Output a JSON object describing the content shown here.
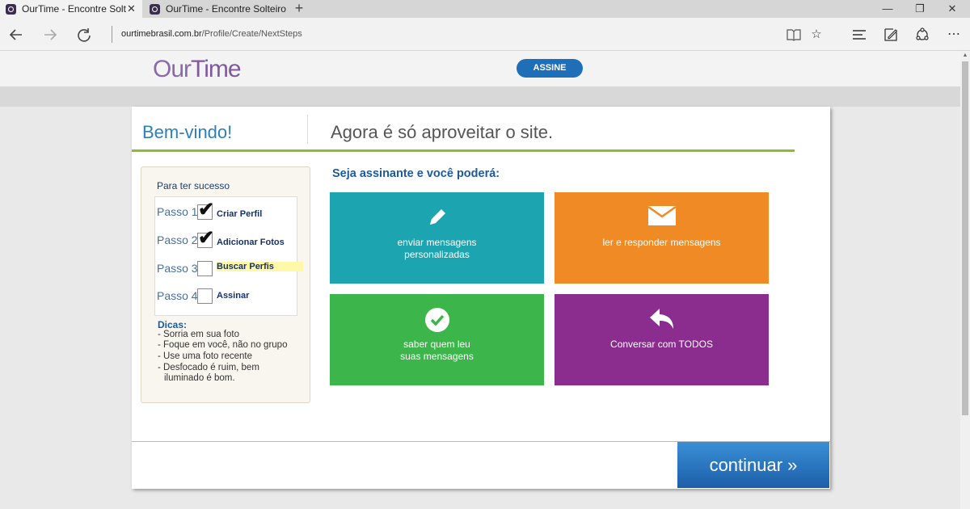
{
  "browser": {
    "tabs": [
      {
        "title": "OurTime - Encontre Solt",
        "close": "✕"
      },
      {
        "title": "OurTime - Encontre Solteiro"
      }
    ],
    "newtab": "+",
    "window_controls": [
      "—",
      "❐",
      "✕"
    ],
    "url_domain": "ourtimebrasil.com.br",
    "url_path": "/Profile/Create/NextSteps",
    "icons": {
      "back": "back-arrow-icon",
      "forward": "forward-arrow-icon",
      "refresh": "refresh-icon",
      "reading_view": "reading-view-icon",
      "favorites": "star-icon",
      "hub": "hub-icon",
      "note": "web-note-icon",
      "share": "share-icon",
      "more": "more-icon"
    }
  },
  "header": {
    "logo_part1": "Our",
    "logo_part2": "Time",
    "subscribe_button": "ASSINE",
    "colors": {
      "logo": "#8a6aab",
      "subscribe": "#1f6fb8"
    }
  },
  "modal": {
    "welcome": "Bem-vindo!",
    "headline": "Agora é só aproveitar o site.",
    "accent_line_color": "#8dbd2c",
    "steps": {
      "title": "Para ter sucesso",
      "items": [
        {
          "label": "Passo 1",
          "text": "Criar Perfil",
          "checked": true
        },
        {
          "label": "Passo 2",
          "text": "Adicionar Fotos",
          "checked": true
        },
        {
          "label": "Passo 3",
          "text": "Buscar Perfis",
          "checked": false,
          "highlighted": true
        },
        {
          "label": "Passo 4",
          "text": "Assinar",
          "checked": false
        }
      ],
      "check_glyph": "✔"
    },
    "tips": {
      "title": "Dicas:",
      "items": [
        "- Sorria em sua foto",
        "- Foque em você, não no grupo",
        "- Use uma foto recente",
        "- Desfocado é ruim, bem",
        "iluminado é bom."
      ]
    },
    "features_title": "Seja assinante e você poderá:",
    "tiles": [
      {
        "line1": "enviar mensagens",
        "line2": "personalizadas",
        "color": "#1ca5b0",
        "icon": "pencil-icon"
      },
      {
        "line1": "ler e responder mensagens",
        "line2": "",
        "color": "#ef8a24",
        "icon": "envelope-icon"
      },
      {
        "line1": "saber quem leu",
        "line2": "suas mensagens",
        "color": "#3cb64a",
        "icon": "check-circle-icon"
      },
      {
        "line1": "Conversar com TODOS",
        "line2": "",
        "color": "#8b2d8e",
        "icon": "reply-arrow-icon"
      }
    ],
    "continue_button": "continuar »"
  }
}
